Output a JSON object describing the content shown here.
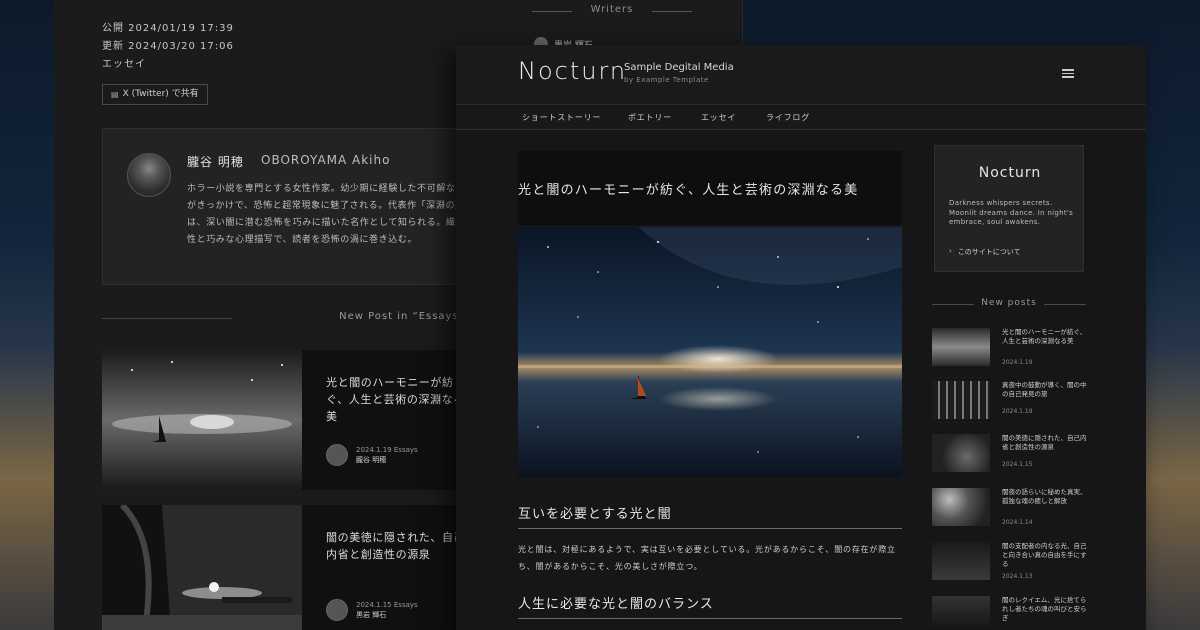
{
  "back_page": {
    "meta": {
      "published": "公開 2024/01/19 17:39",
      "updated": "更新 2024/03/20 17:06",
      "category": "エッセイ"
    },
    "share_label": "X (Twitter) で共有",
    "writers_heading": "Writers",
    "writer_peek_name": "黒岩 輝石",
    "author": {
      "name": "朧谷 明穂",
      "name_roman": "OBOROYAMA Akiho",
      "bio": "ホラー小説を専門とする女性作家。幼少期に経験した不可解な出来事がきっかけで、恐怖と超常現象に魅了される。代表作「深淵の悪夢」は、深い闇に潜む恐怖を巧みに描いた名作として知られる。繊細な感性と巧みな心理描写で、読者を恐怖の渦に巻き込む。"
    },
    "section_title": "New Post in “Essays”",
    "posts": [
      {
        "title": "光と闇のハーモニーが紡ぐ、人生と芸術の深淵なる美",
        "date": "2024.1.19",
        "category": "Essays",
        "author": "朧谷 明穂"
      },
      {
        "title": "闇の美徳に隠された、自己内省と創造性の源泉",
        "date": "2024.1.15",
        "category": "Essays",
        "author": "黒岩 輝石"
      }
    ]
  },
  "front_page": {
    "logo": "Nocturn",
    "tagline": "Sample Degital Media",
    "tagline_sub": "by Example Template",
    "nav": [
      "ショートストーリー",
      "ポエトリー",
      "エッセイ",
      "ライフログ"
    ],
    "article": {
      "title": "光と闇のハーモニーが紡ぐ、人生と芸術の深淵なる美",
      "h2_1": "互いを必要とする光と闇",
      "para_1": "光と闇は、対極にあるようで、実は互いを必要としている。光があるからこそ、闇の存在が際立ち、闇があるからこそ、光の美しさが際立つ。",
      "h2_2": "人生に必要な光と闇のバランス"
    },
    "sidebar": {
      "logo": "Nocturn",
      "description": "Darkness whispers secrets. Moonlit dreams dance. In night's embrace, soul awakens.",
      "link_label": "このサイトについて",
      "section_title": "New posts",
      "posts": [
        {
          "title": "光と闇のハーモニーが紡ぐ、人生と芸術の深淵なる美",
          "date": "2024.1.19"
        },
        {
          "title": "真夜中の鼓動が導く、闇の中の自己発見の旅",
          "date": "2024.1.19"
        },
        {
          "title": "闇の美徳に隠された、自己内省と創造性の源泉",
          "date": "2024.1.15"
        },
        {
          "title": "闇夜の語らいに秘めた真実、孤独な魂の癒しと解放",
          "date": "2024.1.14"
        },
        {
          "title": "闇の支配者の内なる光、自己と向き合い真の自由を手にする",
          "date": "2024.1.13"
        },
        {
          "title": "闇のレクイエム、光に捨てられし者たちの魂の叫びと安らぎ",
          "date": ""
        }
      ]
    }
  },
  "colors": {
    "background": "#1b1b1d",
    "card": "#232325",
    "text": "#d8d8d8",
    "accent": "#ececec"
  }
}
